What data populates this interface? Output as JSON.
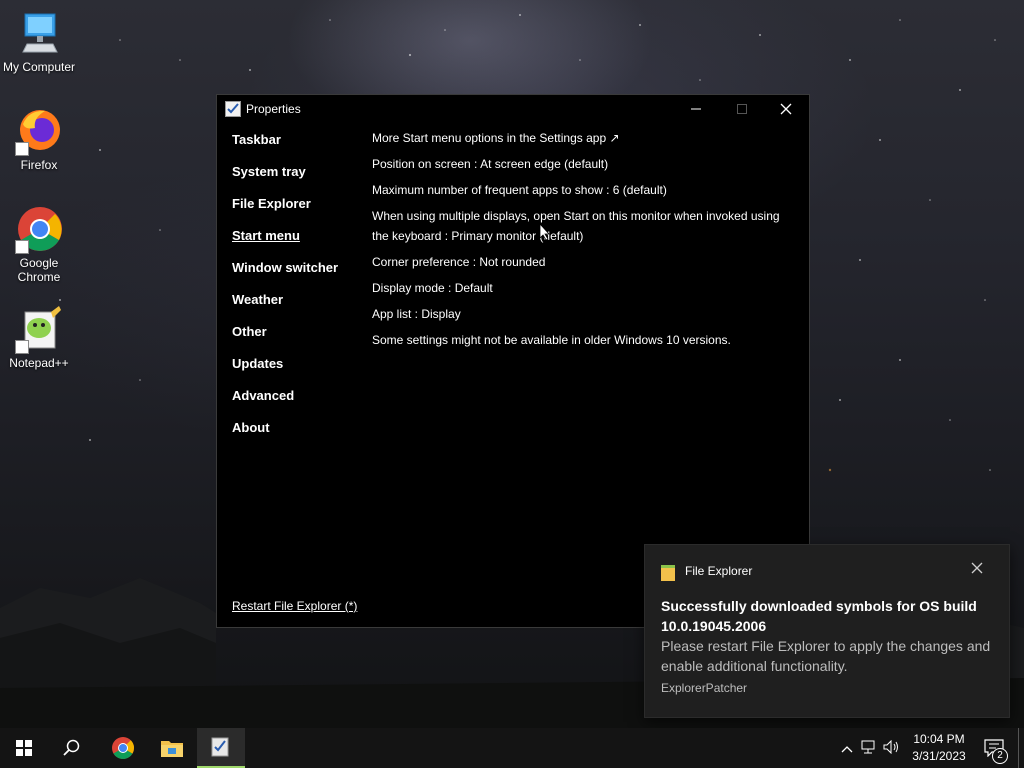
{
  "desktop": {
    "icons": [
      {
        "label": "My Computer"
      },
      {
        "label": "Firefox"
      },
      {
        "label": "Google Chrome"
      },
      {
        "label": "Notepad++"
      }
    ]
  },
  "window": {
    "title": "Properties",
    "nav": [
      {
        "label": "Taskbar"
      },
      {
        "label": "System tray"
      },
      {
        "label": "File Explorer"
      },
      {
        "label": "Start menu",
        "active": true
      },
      {
        "label": "Window switcher"
      },
      {
        "label": "Weather"
      },
      {
        "label": "Other"
      },
      {
        "label": "Updates"
      },
      {
        "label": "Advanced"
      },
      {
        "label": "About"
      }
    ],
    "settings": [
      "More Start menu options in the Settings app ↗",
      "Position on screen : At screen edge (default)",
      "Maximum number of frequent apps to show : 6 (default)",
      "When using multiple displays, open Start on this monitor when invoked using the keyboard : Primary monitor (default)",
      "Corner preference : Not rounded",
      "Display mode : Default",
      "App list : Display",
      "Some settings might not be available in older Windows 10 versions."
    ],
    "restart_link": "Restart File Explorer (*)"
  },
  "toast": {
    "app_name": "File Explorer",
    "title": "Successfully downloaded symbols for OS build 10.0.19045.2006",
    "body": "Please restart File Explorer to apply the changes and enable additional functionality.",
    "source": "ExplorerPatcher"
  },
  "taskbar": {
    "time": "10:04 PM",
    "date": "3/31/2023",
    "notification_count": "2",
    "accent": "#9fd86b"
  }
}
